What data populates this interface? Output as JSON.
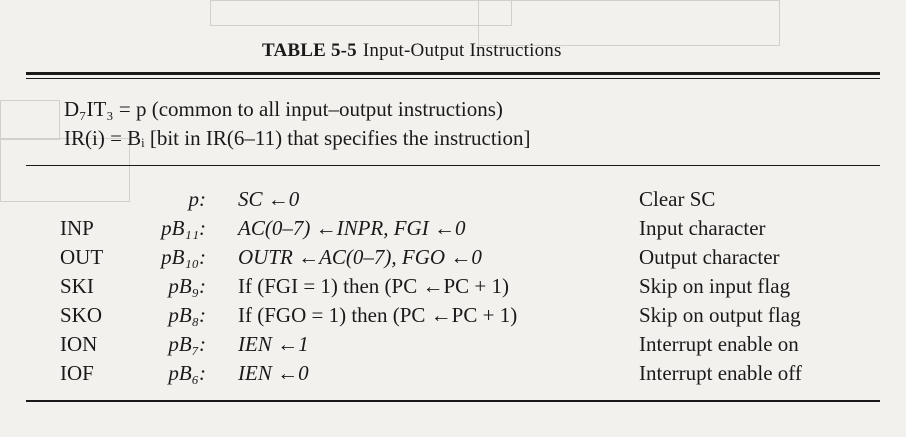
{
  "title": {
    "label": "TABLE 5-5",
    "text": "Input-Output Instructions"
  },
  "definitions": [
    {
      "id": "def-common",
      "text": "D₇IT₃ = p (common to all input–output instructions)"
    },
    {
      "id": "def-ir",
      "text": "IR(i) = Bᵢ [bit in IR(6–11) that specifies the instruction]"
    }
  ],
  "rows": [
    {
      "mnemonic": "",
      "control": "p:",
      "operation": "SC ←0",
      "description": "Clear SC"
    },
    {
      "mnemonic": "INP",
      "control": "pB₁₁:",
      "operation": "AC(0–7) ←INPR,   FGI ←0",
      "description": "Input character"
    },
    {
      "mnemonic": "OUT",
      "control": "pB₁₀:",
      "operation": "OUTR ←AC(0–7),   FGO ←0",
      "description": "Output character"
    },
    {
      "mnemonic": "SKI",
      "control": "pB₉:",
      "operation": "If (FGI = 1) then (PC ←PC + 1)",
      "description": "Skip on input flag"
    },
    {
      "mnemonic": "SKO",
      "control": "pB₈:",
      "operation": "If (FGO = 1) then (PC ←PC + 1)",
      "description": "Skip on output flag"
    },
    {
      "mnemonic": "ION",
      "control": "pB₇:",
      "operation": "IEN ←1",
      "description": "Interrupt enable on"
    },
    {
      "mnemonic": "IOF",
      "control": "pB₆:",
      "operation": "IEN ←0",
      "description": "Interrupt enable off"
    }
  ]
}
